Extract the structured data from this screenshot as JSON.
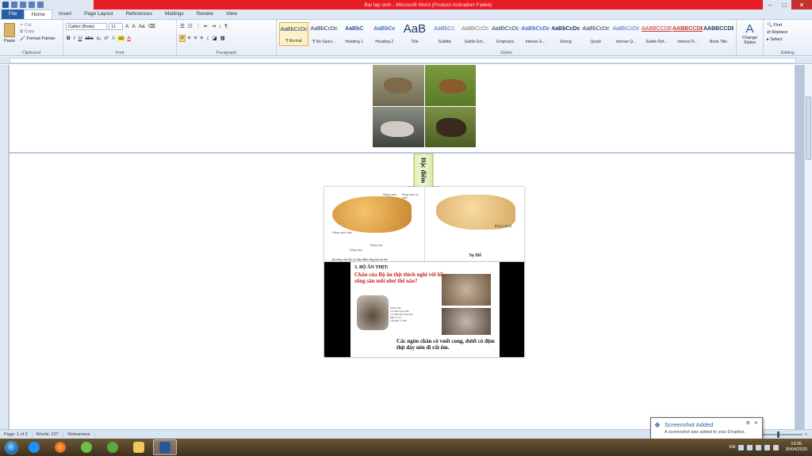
{
  "window": {
    "title": "Bai tap sinh - Microsoft Word (Product Activation Failed)",
    "min": "–",
    "max": "□",
    "close": "✕"
  },
  "ribbon_tabs": [
    "File",
    "Home",
    "Insert",
    "Page Layout",
    "References",
    "Mailings",
    "Review",
    "View"
  ],
  "clipboard": {
    "paste": "Paste",
    "cut": "Cut",
    "copy": "Copy",
    "format_painter": "Format Painter",
    "label": "Clipboard"
  },
  "font": {
    "family": "Calibri (Body)",
    "size": "11",
    "label": "Font",
    "bold": "B",
    "italic": "I",
    "underline": "U",
    "strike": "abc",
    "sub": "x₂",
    "sup": "x²",
    "grow": "A",
    "shrink": "A",
    "case": "Aa"
  },
  "paragraph": {
    "label": "Paragraph",
    "pilcrow": "¶"
  },
  "styles": {
    "label": "Styles",
    "items": [
      {
        "sample": "AaBbCcDc",
        "name": "¶ Normal"
      },
      {
        "sample": "AaBbCcDc",
        "name": "¶ No Spaci..."
      },
      {
        "sample": "AaBbC",
        "name": "Heading 1"
      },
      {
        "sample": "AaBbCc",
        "name": "Heading 2"
      },
      {
        "sample": "AaB",
        "name": "Title"
      },
      {
        "sample": "AaBbCc.",
        "name": "Subtitle"
      },
      {
        "sample": "AaBbCcDc",
        "name": "Subtle Em..."
      },
      {
        "sample": "AaBbCcDc",
        "name": "Emphasis"
      },
      {
        "sample": "AaBbCcDc",
        "name": "Intense E..."
      },
      {
        "sample": "AaBbCcDc",
        "name": "Strong"
      },
      {
        "sample": "AaBbCcDc",
        "name": "Quote"
      },
      {
        "sample": "AaBbCcDc",
        "name": "Intense Q..."
      },
      {
        "sample": "AABBCCDE",
        "name": "Subtle Ref..."
      },
      {
        "sample": "AABBCCDE",
        "name": "Intense R..."
      },
      {
        "sample": "AABBCCDE",
        "name": "Book Title"
      }
    ],
    "change": "Change Styles"
  },
  "editing": {
    "find": "Find",
    "replace": "Replace",
    "select": "Select",
    "label": "Editing"
  },
  "document": {
    "arrow_label": "Đặc điểm",
    "skull_left_caption": "Bộ răng của Sói (1) đặc điểm răng thú ăn thịt",
    "skull_left_labels": [
      "Răng nanh",
      "Răng hàm có mấu",
      "Răng cạnh hàm",
      "Răng cửa",
      "Răng hàm"
    ],
    "skull_right_fang": "Răng nanh",
    "skull_right_caption": "Sọ Hổ",
    "slide_heading": "3. BỘ ĂN THỊT:",
    "slide_question": "Chân của Bộ ăn thịt thích nghi với lối sống săn mồi như thế nào?",
    "paw_labels": [
      "Móng chân",
      "Các đệm ngón chân",
      "Các đệm ngón bàn chân",
      "Đệm cổ tay",
      "Lớp đệm cổ chân"
    ],
    "slide_footer": "Các ngón chân có vuốt cong, dưới có đệm thịt dày nên đi rất êm."
  },
  "status": {
    "page": "Page: 1 of 2",
    "words": "Words: 227",
    "language": "Vietnamese"
  },
  "toast": {
    "title": "Screenshot Added",
    "body": "A screenshot was added to your Dropbox."
  },
  "taskbar": {
    "lang": "EN",
    "time": "13:05",
    "date": "30/04/2020"
  }
}
